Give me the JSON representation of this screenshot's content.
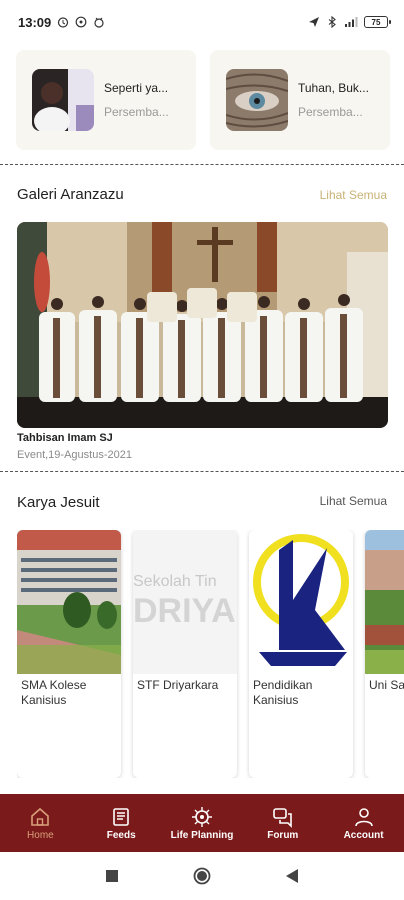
{
  "status": {
    "time": "13:09",
    "battery": "75"
  },
  "top_cards": [
    {
      "title": "Seperti ya...",
      "subtitle": "Persemba..."
    },
    {
      "title": "Tuhan, Buk...",
      "subtitle": "Persemba..."
    }
  ],
  "gallery": {
    "title": "Galeri Aranzazu",
    "see_all": "Lihat Semua",
    "caption": "Tahbisan Imam SJ",
    "date": "Event,19-Agustus-2021"
  },
  "karya": {
    "title": "Karya Jesuit",
    "see_all": "Lihat Semua",
    "items": [
      {
        "label": "SMA Kolese Kanisius"
      },
      {
        "label": "STF Driyarkara",
        "image_text_1": "Sekolah Tin",
        "image_text_2": "DRIYA"
      },
      {
        "label": "Pendidikan Kanisius"
      },
      {
        "label": "Uni San Dha"
      }
    ]
  },
  "nav": {
    "items": [
      {
        "label": "Home",
        "icon": "home-icon"
      },
      {
        "label": "Feeds",
        "icon": "feeds-icon"
      },
      {
        "label": "Life Planning",
        "icon": "life-planning-icon"
      },
      {
        "label": "Forum",
        "icon": "forum-icon"
      },
      {
        "label": "Account",
        "icon": "account-icon"
      }
    ]
  },
  "colors": {
    "nav_bg": "#7a1a1a",
    "active_nav": "#d9a07a",
    "gallery_see_all": "#c8b276",
    "karya_see_all": "#555555"
  }
}
